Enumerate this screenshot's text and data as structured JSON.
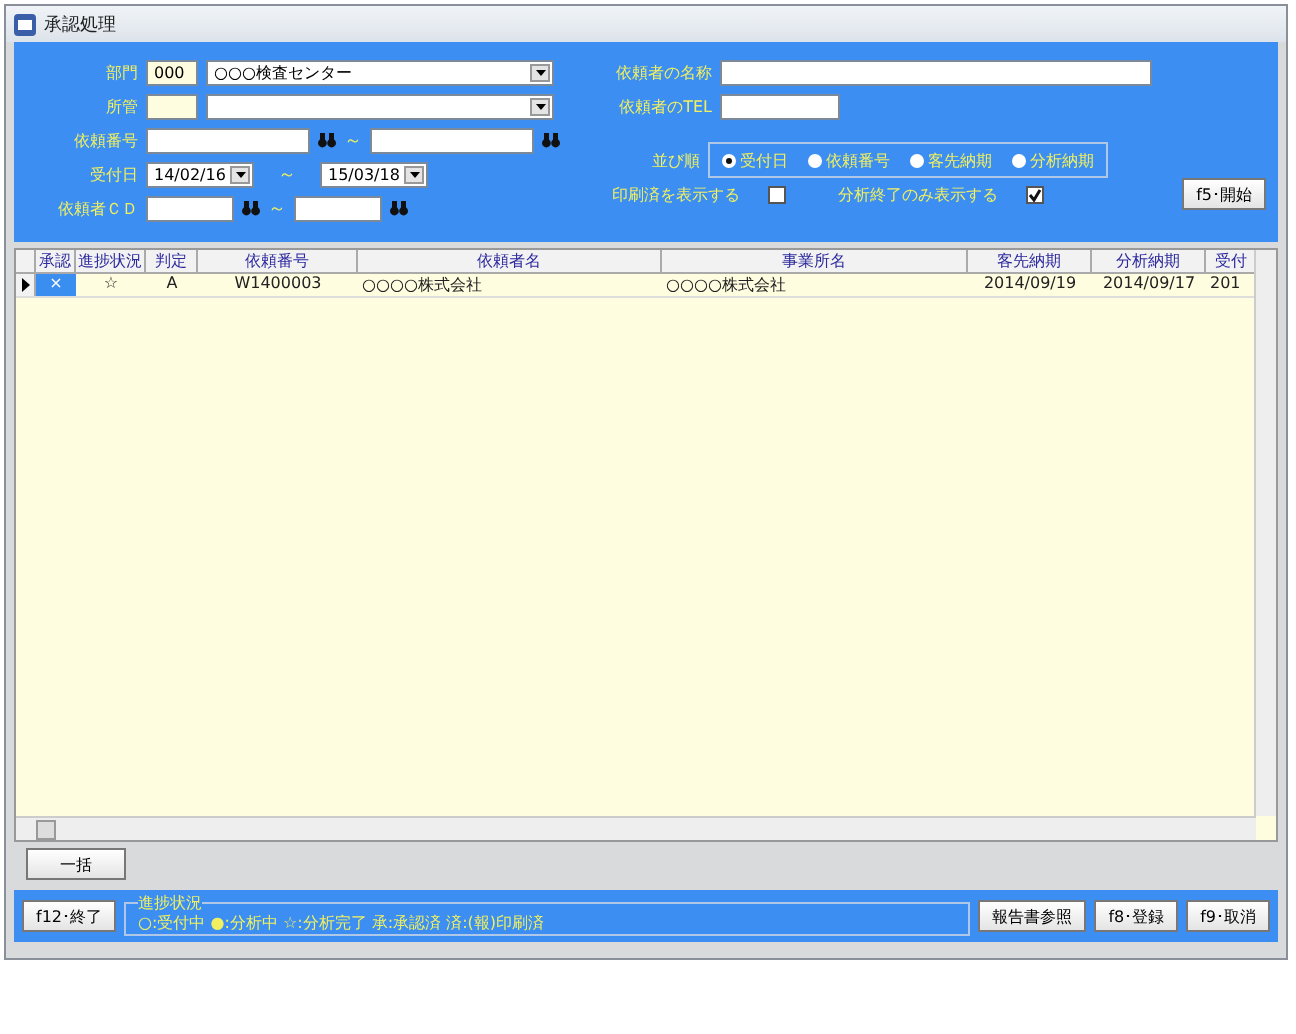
{
  "window": {
    "title": "承認処理"
  },
  "filters": {
    "department": {
      "label": "部門",
      "code": "000",
      "value": "○○○検査センター"
    },
    "jurisdiction": {
      "label": "所管"
    },
    "request_no": {
      "label": "依頼番号",
      "tilde": "～"
    },
    "received": {
      "label": "受付日",
      "from": "14/02/16",
      "tilde": "～",
      "to": "15/03/18"
    },
    "client_cd": {
      "label": "依頼者ＣＤ",
      "tilde": "～"
    },
    "client_name": {
      "label": "依頼者の名称"
    },
    "client_tel": {
      "label": "依頼者のTEL"
    },
    "sort": {
      "label": "並び順",
      "options": [
        {
          "label": "受付日",
          "selected": true
        },
        {
          "label": "依頼番号",
          "selected": false
        },
        {
          "label": "客先納期",
          "selected": false
        },
        {
          "label": "分析納期",
          "selected": false
        }
      ]
    },
    "checks": [
      {
        "label": "印刷済を表示する",
        "checked": false
      },
      {
        "label": "分析終了のみ表示する",
        "checked": true
      }
    ],
    "start_button": "f5･開始"
  },
  "table": {
    "columns": [
      "承認",
      "進捗状況",
      "判定",
      "依頼番号",
      "依頼者名",
      "事業所名",
      "客先納期",
      "分析納期",
      "受付"
    ],
    "rows": [
      {
        "selected": true,
        "cells": [
          "×",
          "☆",
          "A",
          "W1400003",
          "○○○○株式会社",
          "○○○○株式会社",
          "2014/09/19",
          "2014/09/17",
          "201"
        ]
      }
    ]
  },
  "bulk_button": "一括",
  "footer": {
    "exit_button": "f12･終了",
    "legend_title": "進捗状況",
    "legend": "○:受付中 ●:分析中 ☆:分析完了 承:承認済 済:(報)印刷済",
    "buttons": [
      "報告書参照",
      "f8･登録",
      "f9･取消"
    ]
  }
}
